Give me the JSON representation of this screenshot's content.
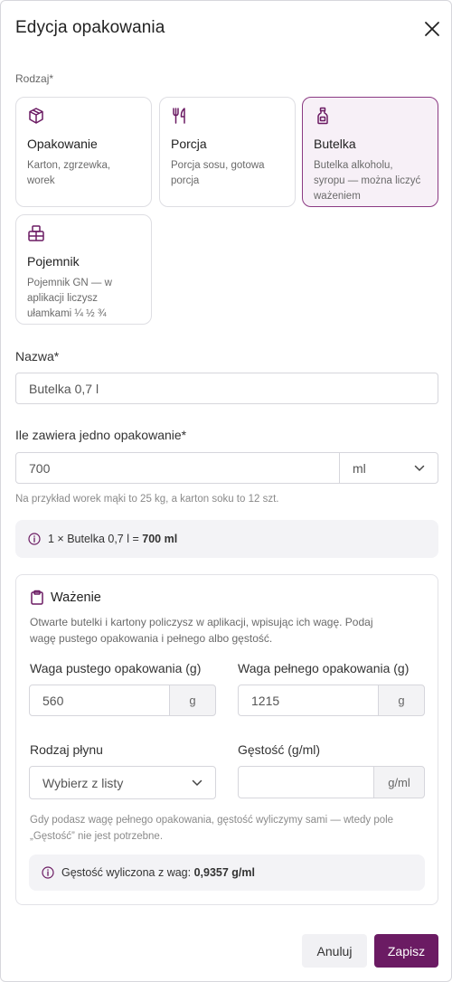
{
  "dialog": {
    "title": "Edycja opakowania"
  },
  "type_section": {
    "label": "Rodzaj*",
    "options": [
      {
        "title": "Opakowanie",
        "desc_lines": [
          "Karton, zgrzewka,",
          "worek"
        ],
        "icon": "box-icon",
        "selected": false
      },
      {
        "title": "Porcja",
        "desc_lines": [
          "Porcja sosu, gotowa",
          "porcja"
        ],
        "icon": "fork-icon",
        "selected": false
      },
      {
        "title": "Butelka",
        "desc_lines": [
          "Butelka alkoholu,",
          "syropu — można liczyć",
          "ważeniem"
        ],
        "icon": "bottle-icon",
        "selected": true
      },
      {
        "title": "Pojemnik",
        "desc_lines": [
          "Pojemnik GN — w",
          "aplikacji liczysz",
          "ułamkami ¼ ½ ¾"
        ],
        "icon": "container-icon",
        "selected": false
      }
    ]
  },
  "name_field": {
    "label": "Nazwa*",
    "value": "Butelka 0,7 l"
  },
  "contents_field": {
    "label": "Ile zawiera jedno opakowanie*",
    "value": "700",
    "unit": "ml",
    "hint": "Na przykład worek mąki to 25 kg, a karton soku to 12 szt."
  },
  "summary": {
    "text": "1 × Butelka 0,7 l = ",
    "bold": "700 ml"
  },
  "weighing": {
    "title": "Ważenie",
    "desc_lines": [
      "Otwarte butelki i kartony policzysz w aplikacji, wpisując ich wagę. Podaj",
      "wagę pustego opakowania i pełnego albo gęstość."
    ],
    "empty_weight": {
      "label": "Waga pustego opakowania (g)",
      "value": "560",
      "unit": "g"
    },
    "full_weight": {
      "label": "Waga pełnego opakowania (g)",
      "value": "1215",
      "unit": "g"
    },
    "liquid_type": {
      "label": "Rodzaj płynu",
      "value": "Wybierz z listy"
    },
    "density": {
      "label": "Gęstość (g/ml)",
      "value": "",
      "unit": "g/ml"
    },
    "hint_lines": [
      "Gdy podasz wagę pełnego opakowania, gęstość wyliczymy sami — wtedy pole",
      "„Gęstość” nie jest potrzebne."
    ],
    "computed": {
      "text": "Gęstość wyliczona z wag: ",
      "bold": "0,9357 g/ml"
    }
  },
  "footer": {
    "cancel_label": "Anuluj",
    "save_label": "Zapisz"
  },
  "colors": {
    "accent": "#6b1b63",
    "selected_bg": "#f7f0f7",
    "info_bg": "#f3f3f6"
  }
}
